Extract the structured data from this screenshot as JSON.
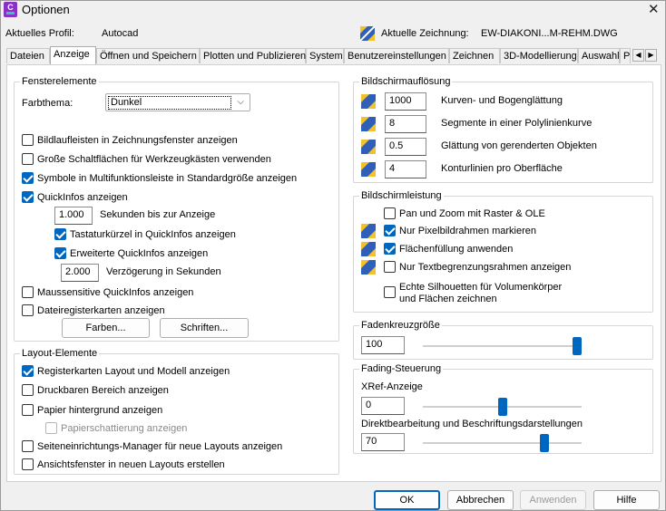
{
  "window": {
    "title": "Optionen",
    "icon_text": "C"
  },
  "header": {
    "profile_label": "Aktuelles Profil:",
    "profile_value": "Autocad",
    "drawing_label": "Aktuelle Zeichnung:",
    "drawing_value": "EW-DIAKONI...M-REHM.DWG"
  },
  "tabs": [
    {
      "label": "Dateien"
    },
    {
      "label": "Anzeige",
      "active": true
    },
    {
      "label": "Öffnen und Speichern"
    },
    {
      "label": "Plotten und Publizieren"
    },
    {
      "label": "System"
    },
    {
      "label": "Benutzereinstellungen"
    },
    {
      "label": "Zeichnen"
    },
    {
      "label": "3D-Modellierung"
    },
    {
      "label": "Auswahl"
    },
    {
      "label": "P"
    }
  ],
  "fensterelemente": {
    "title": "Fensterelemente",
    "farbthema_label": "Farbthema:",
    "farbthema_value": "Dunkel",
    "checkboxes": [
      {
        "label": "Bildlaufleisten in Zeichnungsfenster anzeigen",
        "checked": false
      },
      {
        "label": "Große Schaltflächen für Werkzeugkästen verwenden",
        "checked": false
      },
      {
        "label": "Symbole in Multifunktionsleiste in Standardgröße anzeigen",
        "checked": true
      },
      {
        "label": "QuickInfos anzeigen",
        "checked": true
      }
    ],
    "seconds_value": "1.000",
    "seconds_label": "Sekunden bis zur Anzeige",
    "sub_checkboxes": [
      {
        "label": "Tastaturkürzel in QuickInfos anzeigen",
        "checked": true
      },
      {
        "label": "Erweiterte QuickInfos anzeigen",
        "checked": true
      }
    ],
    "delay_value": "2.000",
    "delay_label": "Verzögerung in Sekunden",
    "checkboxes2": [
      {
        "label": "Maussensitive QuickInfos anzeigen",
        "checked": false
      },
      {
        "label": "Dateiregisterkarten anzeigen",
        "checked": false
      }
    ],
    "colors_button": "Farben...",
    "fonts_button": "Schriften..."
  },
  "layout_elemente": {
    "title": "Layout-Elemente",
    "checkboxes": [
      {
        "label": "Registerkarten Layout und Modell anzeigen",
        "checked": true
      },
      {
        "label": "Druckbaren Bereich anzeigen",
        "checked": false
      },
      {
        "label": "Papier hintergrund anzeigen",
        "checked": false
      }
    ],
    "disabled_checkbox": {
      "label": "Papierschattierung anzeigen",
      "checked": false
    },
    "checkboxes2": [
      {
        "label": "Seiteneinrichtungs-Manager für neue Layouts anzeigen",
        "checked": false
      },
      {
        "label": "Ansichtsfenster in neuen Layouts erstellen",
        "checked": false
      }
    ]
  },
  "bildschirmaufloesung": {
    "title": "Bildschirmauflösung",
    "rows": [
      {
        "value": "1000",
        "label": "Kurven- und Bogenglättung"
      },
      {
        "value": "8",
        "label": "Segmente in einer Polylinienkurve"
      },
      {
        "value": "0.5",
        "label": "Glättung von gerenderten Objekten"
      },
      {
        "value": "4",
        "label": "Konturlinien pro Oberfläche"
      }
    ]
  },
  "bildschirmleistung": {
    "title": "Bildschirmleistung",
    "items": [
      {
        "label": "Pan und Zoom mit Raster & OLE",
        "checked": false
      },
      {
        "label": "Nur Pixelbildrahmen markieren",
        "checked": true
      },
      {
        "label": "Flächenfüllung anwenden",
        "checked": true
      },
      {
        "label": "Nur Textbegrenzungsrahmen anzeigen",
        "checked": false
      }
    ],
    "last_item": {
      "label_line1": "Echte Silhouetten für Volumenkörper",
      "label_line2": "und Flächen zeichnen",
      "checked": false
    }
  },
  "fadenkreuz": {
    "title": "Fadenkreuzgröße",
    "value": "100",
    "slider_percent": 100
  },
  "fading": {
    "title": "Fading-Steuerung",
    "xref_label": "XRef-Anzeige",
    "xref_value": "0",
    "xref_percent": 50,
    "direkt_label": "Direktbearbeitung und Beschriftungsdarstellungen",
    "direkt_value": "70",
    "direkt_percent": 78
  },
  "footer": {
    "ok": "OK",
    "cancel": "Abbrechen",
    "apply": "Anwenden",
    "help": "Hilfe"
  },
  "colors": {
    "accent": "#0067c0",
    "app_icon": "#8b2fc9",
    "icon_blue": "#2f5fb8",
    "icon_yellow": "#f2c12e"
  }
}
